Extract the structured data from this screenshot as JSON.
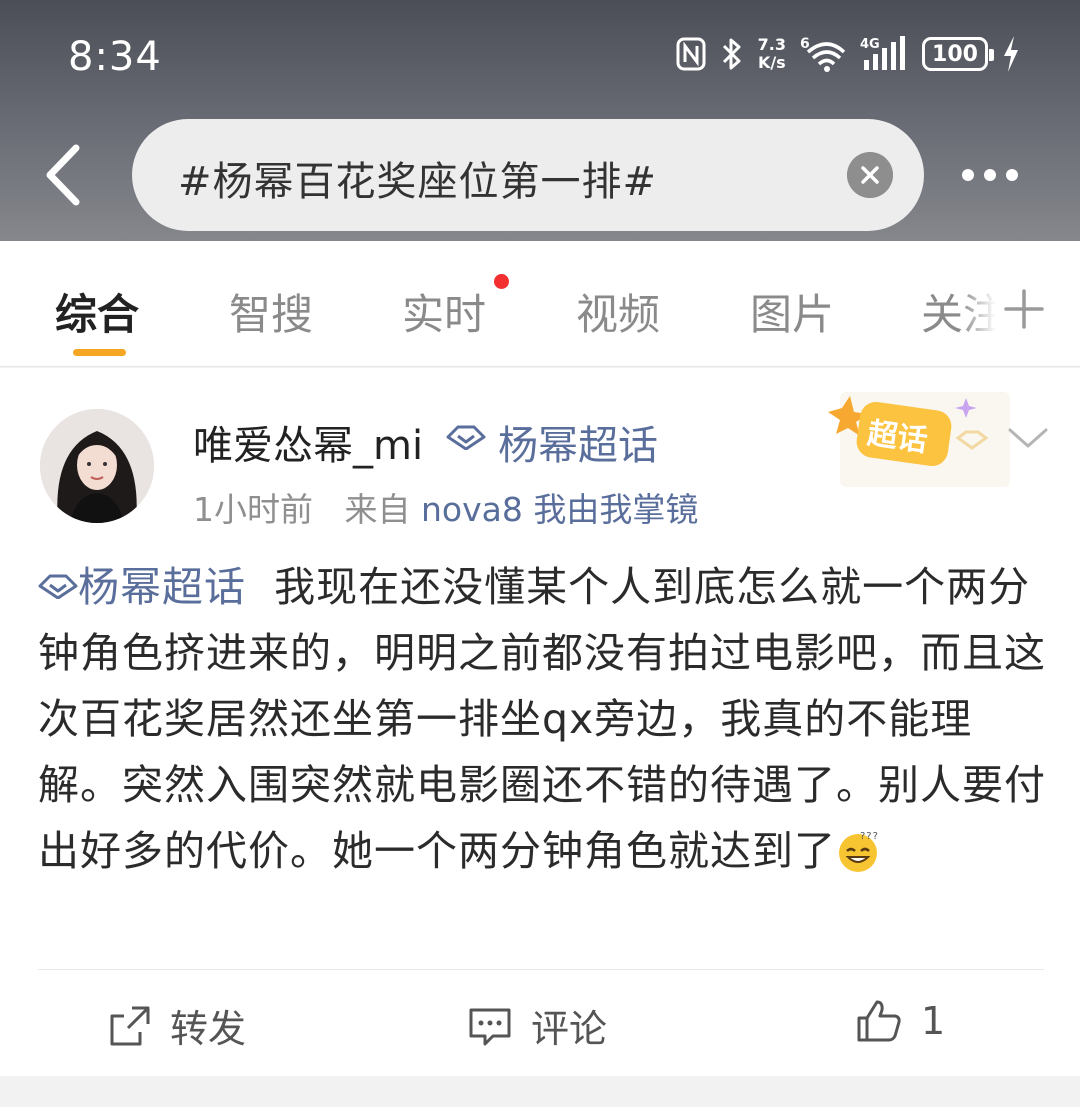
{
  "status_bar": {
    "time": "8:34",
    "net_speed_value": "7.3",
    "net_speed_unit": "K/s",
    "wifi_label": "6",
    "cell_label": "4G",
    "battery": "100"
  },
  "search": {
    "query": "#杨幂百花奖座位第一排#"
  },
  "tabs": [
    {
      "label": "综合",
      "active": true
    },
    {
      "label": "智搜"
    },
    {
      "label": "实时",
      "has_dot": true
    },
    {
      "label": "视频"
    },
    {
      "label": "图片"
    },
    {
      "label": "关注"
    }
  ],
  "post": {
    "username": "唯爱怂幂_mi",
    "topic_badge": "杨幂超话",
    "time": "1小时前",
    "source_prefix": "来自",
    "source": "nova8 我由我掌镜",
    "chaohua_label": "超话",
    "topic_link": "杨幂超话",
    "text": "我现在还没懂某个人到底怎么就一个两分钟角色挤进来的，明明之前都没有拍过电影吧，而且这次百花奖居然还坐第一排坐qx旁边，我真的不能理解。突然入围突然就电影圈还不错的待遇了。别人要付出好多的代价。她一个两分钟角色就达到了"
  },
  "actions": {
    "repost": "转发",
    "comment": "评论",
    "likes": "1"
  }
}
